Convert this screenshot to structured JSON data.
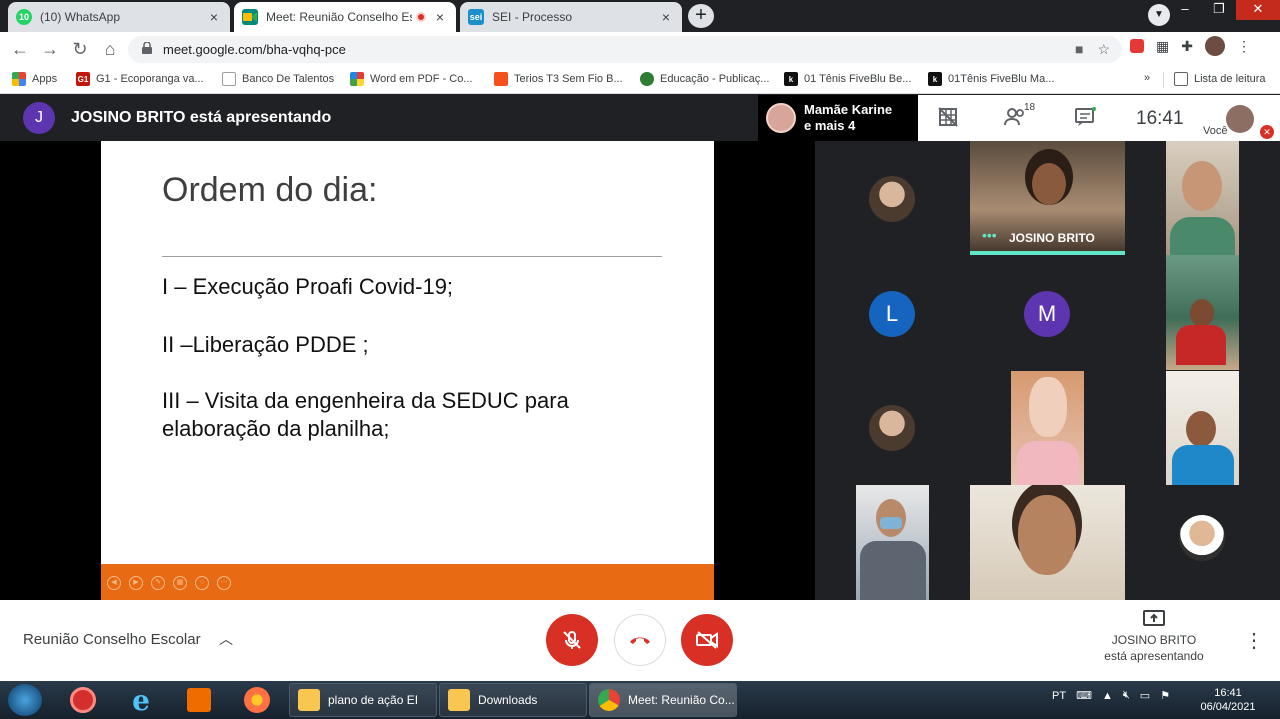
{
  "browser": {
    "tabs": [
      {
        "title": "(10) WhatsApp",
        "badge": "10",
        "close": "×"
      },
      {
        "title": "Meet: Reunião Conselho Esc",
        "close": "×"
      },
      {
        "title": "SEI - Processo",
        "favicon_text": "sei",
        "close": "×"
      }
    ],
    "url": "meet.google.com/bha-vqhq-pce",
    "bookmarks": [
      {
        "label": "Apps"
      },
      {
        "label": "G1 - Ecoporanga va...",
        "icon_text": "G1"
      },
      {
        "label": "Banco De Talentos"
      },
      {
        "label": "Word em PDF - Co..."
      },
      {
        "label": "Terios T3 Sem Fio B..."
      },
      {
        "label": "Educação - Publicaç..."
      },
      {
        "label": "01 Tênis FiveBlu Be...",
        "icon_text": "k"
      },
      {
        "label": "01Tênis FiveBlu Ma...",
        "icon_text": "k"
      },
      {
        "label": "Lista de leitura"
      }
    ],
    "bookmarks_more": "»"
  },
  "meet": {
    "presenter_initial": "J",
    "presenter_text": "JOSINO BRITO está apresentando",
    "others_chip": {
      "line1": "Mamãe Karine",
      "line2": "e mais 4"
    },
    "participant_count": "18",
    "time": "16:41",
    "self_label": "Você",
    "slide": {
      "heading": "Ordem do dia:",
      "items": [
        "I – Execução Proafi Covid-19;",
        "II –Liberação PDDE ;",
        "III – Visita da engenheira da SEDUC para elaboração da planilha;"
      ]
    },
    "tiles": {
      "speaker_name": "JOSINO BRITO",
      "avatar_L": "L",
      "avatar_M": "M"
    },
    "meeting_name": "Reunião Conselho Escolar",
    "presenting_line1": "JOSINO BRITO",
    "presenting_line2": "está apresentando"
  },
  "taskbar": {
    "tasks": [
      "plano de ação EI",
      "Downloads",
      "Meet: Reunião Co..."
    ],
    "lang": "PT",
    "time": "16:41",
    "date": "06/04/2021"
  },
  "colors": {
    "accent_red": "#d93025",
    "slide_orange": "#e86a12",
    "speaking_teal": "#5ee6c6",
    "presenter_avatar": "#5e35b1",
    "avatar_L": "#1565c0",
    "avatar_M": "#5e35b1"
  }
}
